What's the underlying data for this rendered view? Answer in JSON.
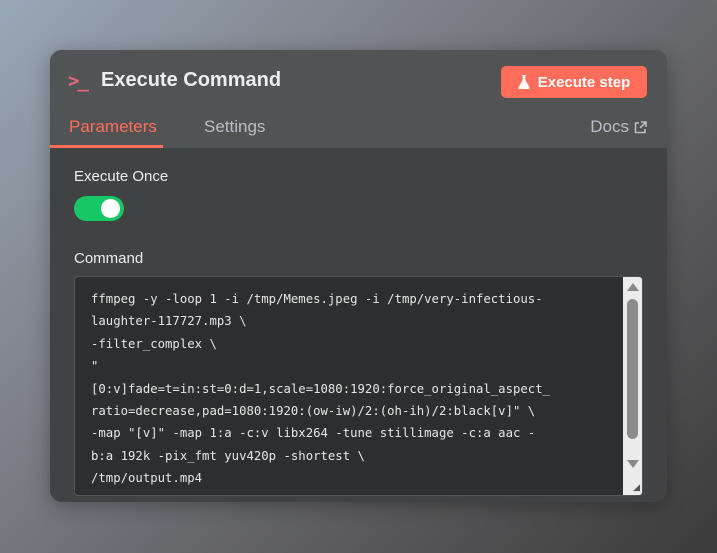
{
  "header": {
    "title": "Execute Command",
    "icon": "terminal-icon",
    "icon_glyph": ">_",
    "execute_button": "Execute step"
  },
  "tabs": [
    {
      "label": "Parameters",
      "active": true
    },
    {
      "label": "Settings",
      "active": false
    }
  ],
  "docs_link": "Docs",
  "fields": {
    "execute_once": {
      "label": "Execute Once",
      "value": true
    },
    "command": {
      "label": "Command",
      "lines": [
        "ffmpeg -y -loop 1 -i /tmp/Memes.jpeg -i /tmp/very-infectious-",
        "laughter-117727.mp3 \\",
        "-filter_complex \\",
        "\"",
        "[0:v]fade=t=in:st=0:d=1,scale=1080:1920:force_original_aspect_",
        "ratio=decrease,pad=1080:1920:(ow-iw)/2:(oh-ih)/2:black[v]\" \\",
        "-map \"[v]\" -map 1:a -c:v libx264 -tune stillimage -c:a aac -",
        "b:a 192k -pix_fmt yuv420p -shortest \\",
        "/tmp/output.mp4"
      ]
    }
  },
  "colors": {
    "accent": "#ff6d5a",
    "toggle_on": "#16c766"
  }
}
